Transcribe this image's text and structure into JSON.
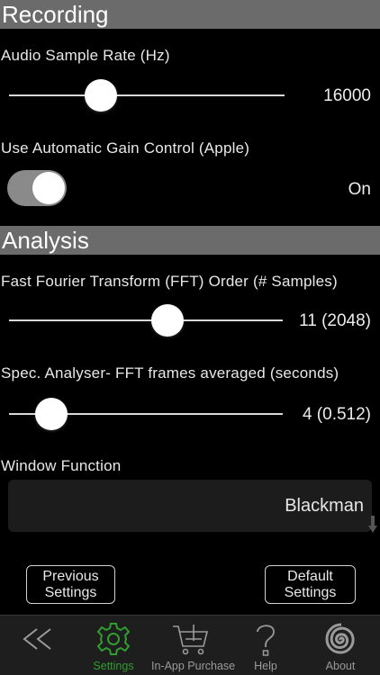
{
  "recording": {
    "header": "Recording",
    "sample_rate": {
      "label": "Audio Sample Rate (Hz)",
      "value": "16000",
      "level": 0.31
    },
    "agc": {
      "label": "Use Automatic Gain Control (Apple)",
      "value": "On",
      "on": true
    }
  },
  "analysis": {
    "header": "Analysis",
    "fft_order": {
      "label": "Fast Fourier Transform (FFT) Order (# Samples)",
      "value": "11 (2048)",
      "level": 0.59
    },
    "frames_averaged": {
      "label": "Spec. Analyser- FFT frames averaged (seconds)",
      "value": "4 (0.512)",
      "level": 0.11
    },
    "window_function": {
      "label": "Window Function",
      "value": "Blackman"
    }
  },
  "buttons": {
    "previous": {
      "line1": "Previous",
      "line2": "Settings"
    },
    "default": {
      "line1": "Default",
      "line2": "Settings"
    }
  },
  "tabbar": {
    "back": {
      "icon": "double-chevron-left-icon"
    },
    "settings": {
      "label": "Settings",
      "icon": "gear-icon",
      "active": true
    },
    "purchase": {
      "label": "In-App Purchase",
      "icon": "cart-plus-icon"
    },
    "help": {
      "label": "Help",
      "icon": "question-icon"
    },
    "about": {
      "label": "About",
      "icon": "spiral-icon"
    }
  },
  "colors": {
    "header_bg": "#6b6b6b",
    "accent_green": "#2f9e2f",
    "tabbar_bg": "#1e1e1e"
  }
}
